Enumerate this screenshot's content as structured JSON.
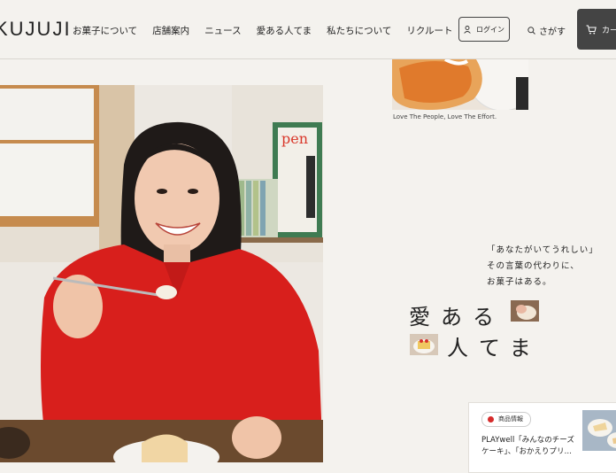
{
  "header": {
    "logo": "KUJUJI",
    "nav": [
      {
        "label": "お菓子について"
      },
      {
        "label": "店舗案内"
      },
      {
        "label": "ニュース"
      },
      {
        "label": "愛ある人てま"
      },
      {
        "label": "私たちについて"
      },
      {
        "label": "リクルート"
      }
    ],
    "login_label": "ログイン",
    "search_label": "さがす",
    "cart_label": "カー"
  },
  "feature": {
    "caption": "Love The People, Love The Effort.",
    "message_lines": [
      "「あなたがいてうれしい」",
      "その言葉の代わりに、",
      "お菓子はある。"
    ],
    "title_line1": "愛ある",
    "title_line2": "人てま"
  },
  "news": {
    "tag": "商品情報",
    "title": "PLAYwell「みんなのチーズケーキ」、「おかえりプリ…"
  },
  "colors": {
    "background": "#f4f2ee",
    "accent_red": "#d62b2b",
    "cart_bg": "#444444"
  }
}
